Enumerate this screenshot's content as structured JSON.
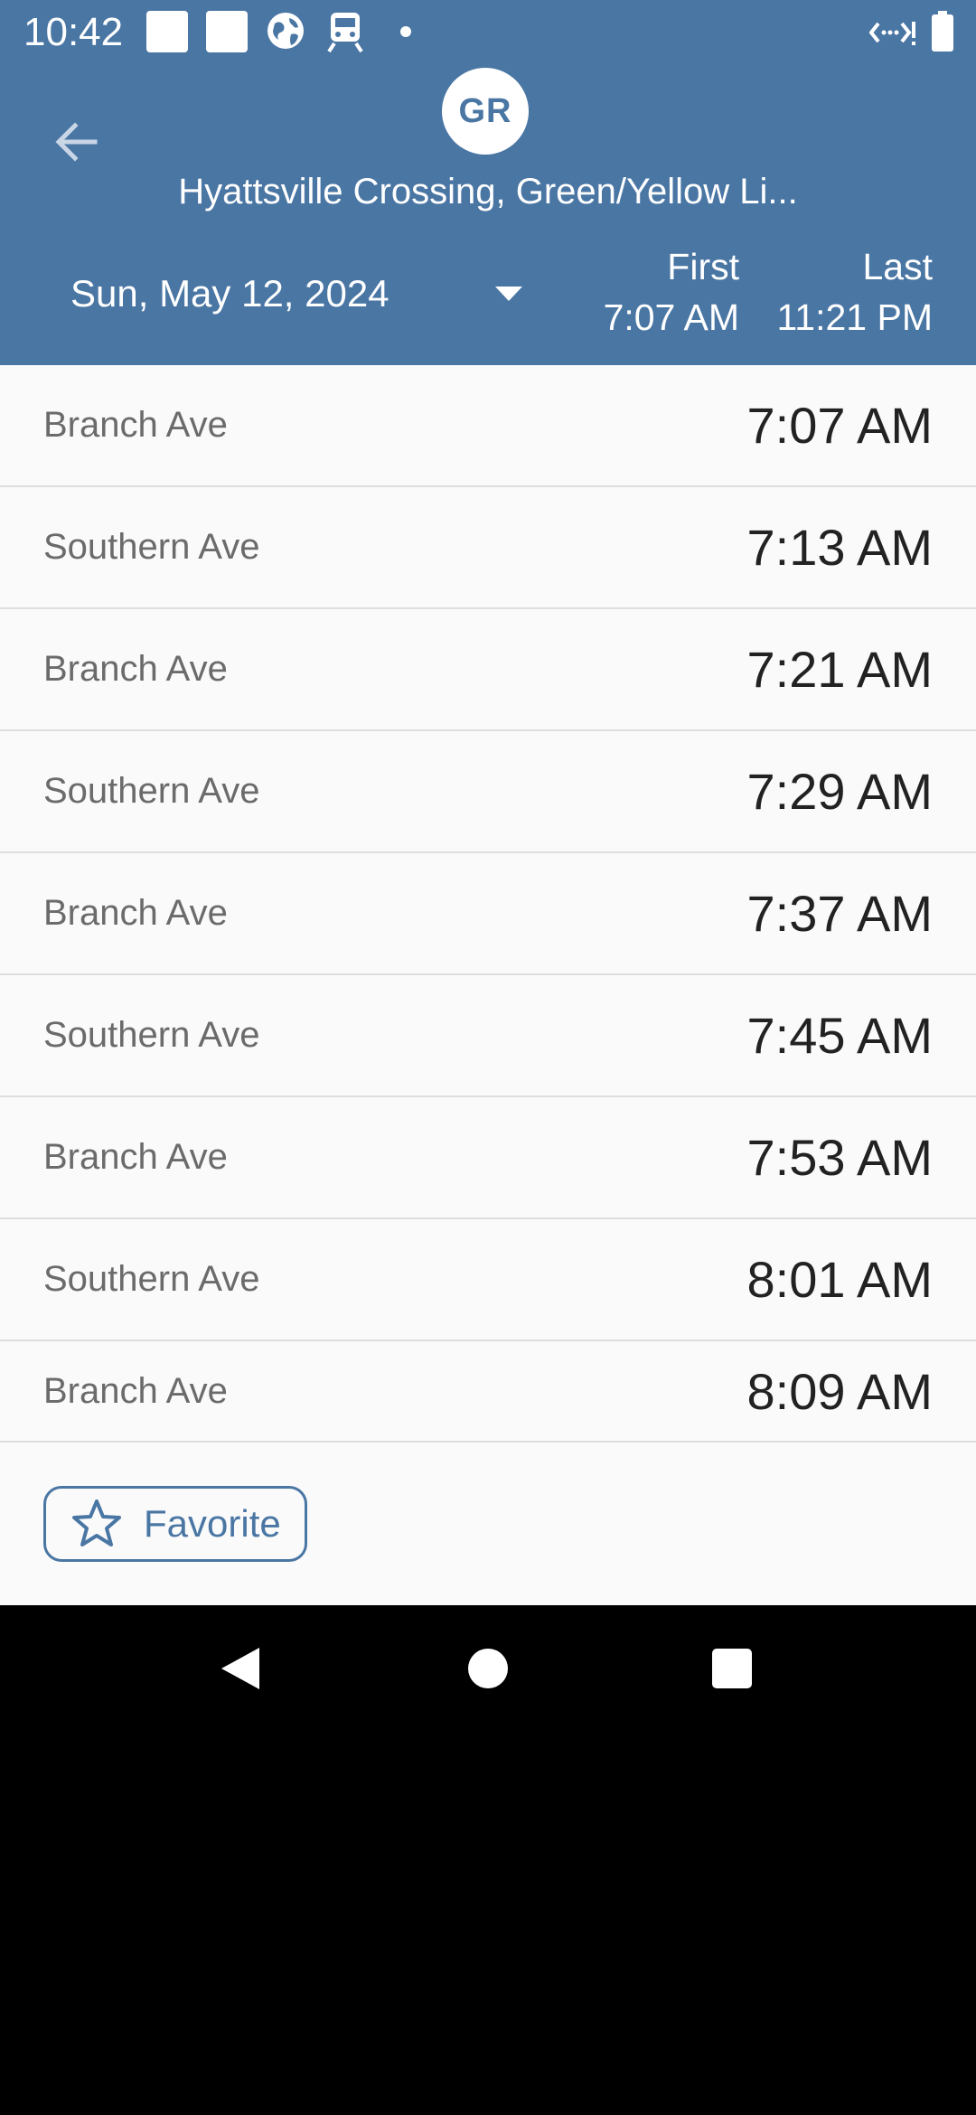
{
  "status_bar": {
    "time": "10:42",
    "icons": [
      "notification-square-icon",
      "notification-square-icon",
      "globe-icon",
      "train-icon",
      "dot-icon",
      "network-icon",
      "battery-icon"
    ]
  },
  "header": {
    "line_badge": "GR",
    "station_title": "Hyattsville Crossing, Green/Yellow Li...",
    "date": "Sun, May 12, 2024",
    "first_label": "First",
    "first_time": "7:07 AM",
    "last_label": "Last",
    "last_time": "11:21 PM"
  },
  "trains": [
    {
      "destination": "Branch Ave",
      "time": "7:07 AM"
    },
    {
      "destination": "Southern Ave",
      "time": "7:13 AM"
    },
    {
      "destination": "Branch Ave",
      "time": "7:21 AM"
    },
    {
      "destination": "Southern Ave",
      "time": "7:29 AM"
    },
    {
      "destination": "Branch Ave",
      "time": "7:37 AM"
    },
    {
      "destination": "Southern Ave",
      "time": "7:45 AM"
    },
    {
      "destination": "Branch Ave",
      "time": "7:53 AM"
    },
    {
      "destination": "Southern Ave",
      "time": "8:01 AM"
    },
    {
      "destination": "Branch Ave",
      "time": "8:09 AM"
    }
  ],
  "footer": {
    "favorite_label": "Favorite"
  },
  "colors": {
    "header_bg": "#4a76a4",
    "list_bg": "#fafafa",
    "divider": "#dedede"
  }
}
